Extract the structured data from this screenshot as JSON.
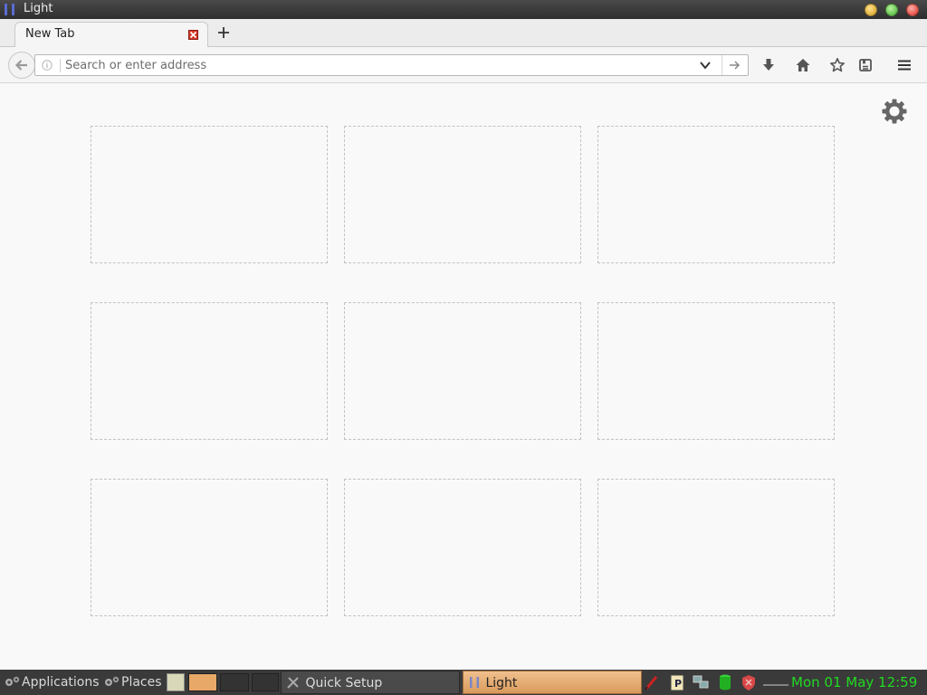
{
  "window": {
    "title": "Light"
  },
  "tabs": [
    {
      "label": "New Tab"
    }
  ],
  "urlbar": {
    "placeholder": "Search or enter address"
  },
  "toolbar_icons": [
    "download-icon",
    "home-icon",
    "bookmark-star-icon",
    "reading-list-icon",
    "hamburger-menu-icon"
  ],
  "newtab": {
    "tile_count": 9,
    "tiles": [
      "",
      "",
      "",
      "",
      "",
      "",
      "",
      "",
      ""
    ]
  },
  "taskbar": {
    "applications_label": "Applications",
    "places_label": "Places",
    "tasks": [
      {
        "label": "Quick Setup"
      },
      {
        "label": "Light"
      }
    ],
    "clock": "Mon 01 May 12:59"
  },
  "colors": {
    "accent_tab_active": "#d99a5b",
    "clock_green": "#22d822",
    "close_red": "#d53a2a"
  }
}
